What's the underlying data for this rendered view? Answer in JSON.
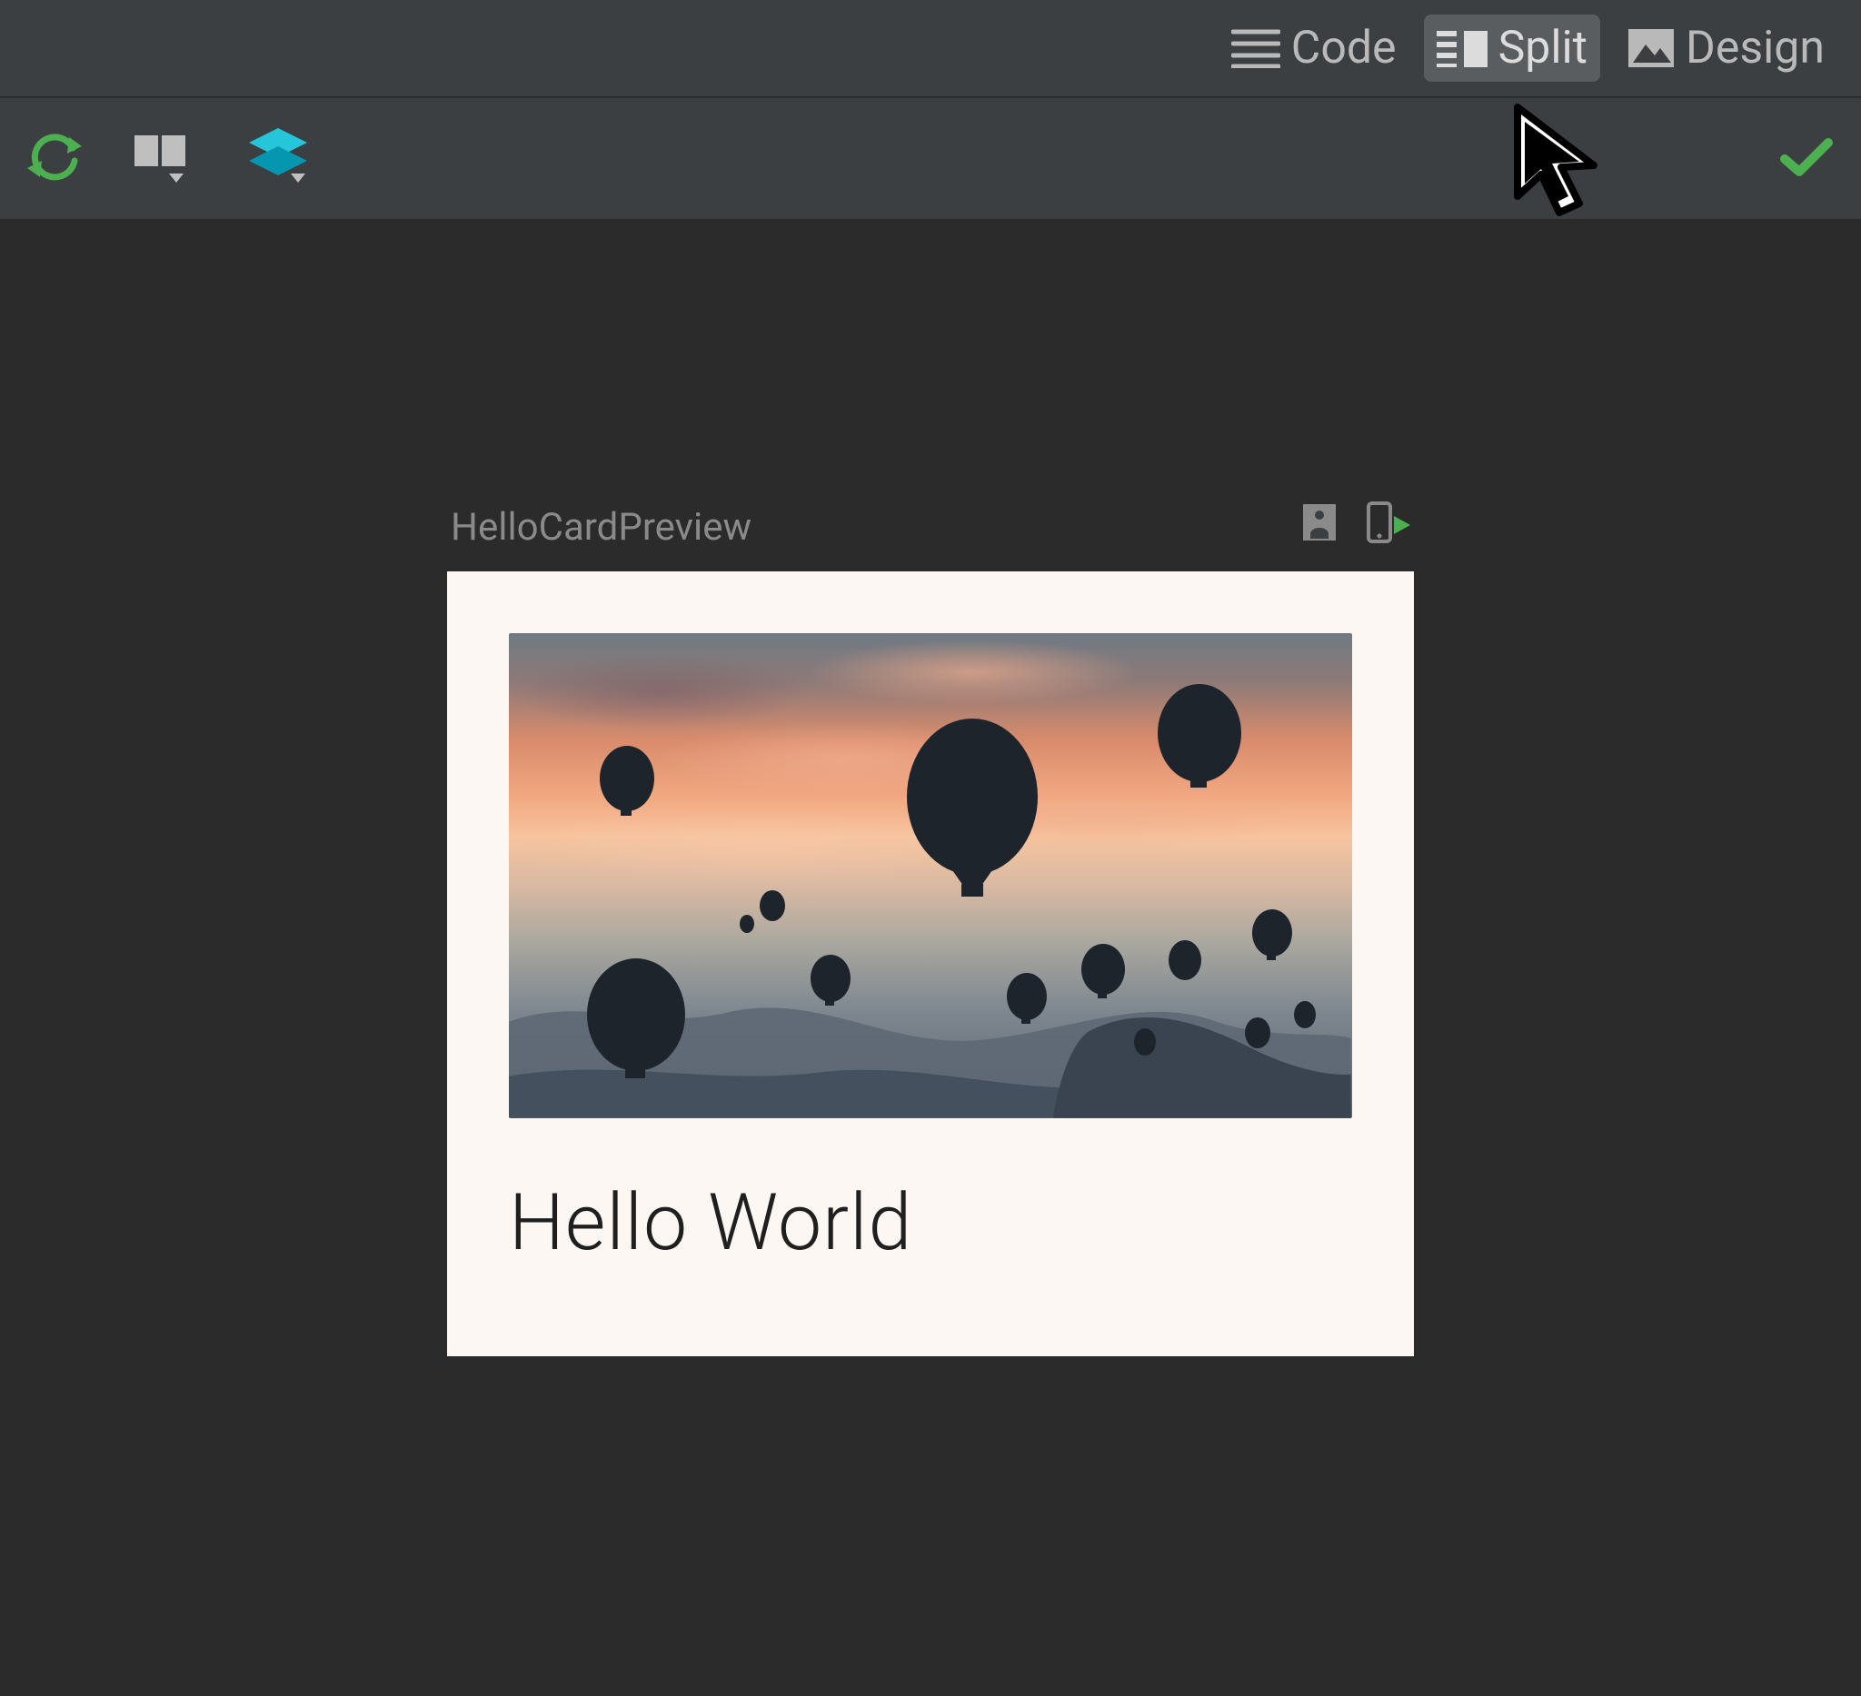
{
  "tabs": {
    "code": "Code",
    "split": "Split",
    "design": "Design",
    "active": "split"
  },
  "preview": {
    "name": "HelloCardPreview",
    "card_title": "Hello World"
  }
}
